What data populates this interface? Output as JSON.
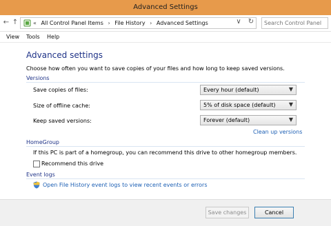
{
  "window": {
    "title": "Advanced Settings"
  },
  "nav": {
    "back_glyph": "←",
    "forward_glyph": "→",
    "up_glyph": "↑",
    "breadcrumb": [
      "«",
      "All Control Panel Items",
      "›",
      "File History",
      "›",
      "Advanced Settings"
    ],
    "dropdown_glyph": "∨",
    "refresh_glyph": "↻",
    "search_placeholder": "Search Control Panel"
  },
  "menu": {
    "items": [
      "View",
      "Tools",
      "Help"
    ]
  },
  "main": {
    "heading": "Advanced settings",
    "description": "Choose how often you want to save copies of your files and how long to keep saved versions.",
    "versions": {
      "label": "Versions",
      "rows": [
        {
          "label": "Save copies of files:",
          "value": "Every hour (default)"
        },
        {
          "label": "Size of offline cache:",
          "value": "5% of disk space (default)"
        },
        {
          "label": "Keep saved versions:",
          "value": "Forever (default)"
        }
      ],
      "cleanup_link": "Clean up versions"
    },
    "homegroup": {
      "label": "HomeGroup",
      "text": "If this PC is part of a homegroup, you can recommend this drive to other homegroup members.",
      "checkbox_label": "Recommend this drive",
      "checkbox_checked": false
    },
    "eventlogs": {
      "label": "Event logs",
      "link": "Open File History event logs to view recent events or errors"
    }
  },
  "footer": {
    "save_label": "Save changes",
    "cancel_label": "Cancel"
  },
  "colors": {
    "titlebar": "#e79a4b",
    "heading": "#1e3287",
    "link": "#1c5fb4"
  }
}
